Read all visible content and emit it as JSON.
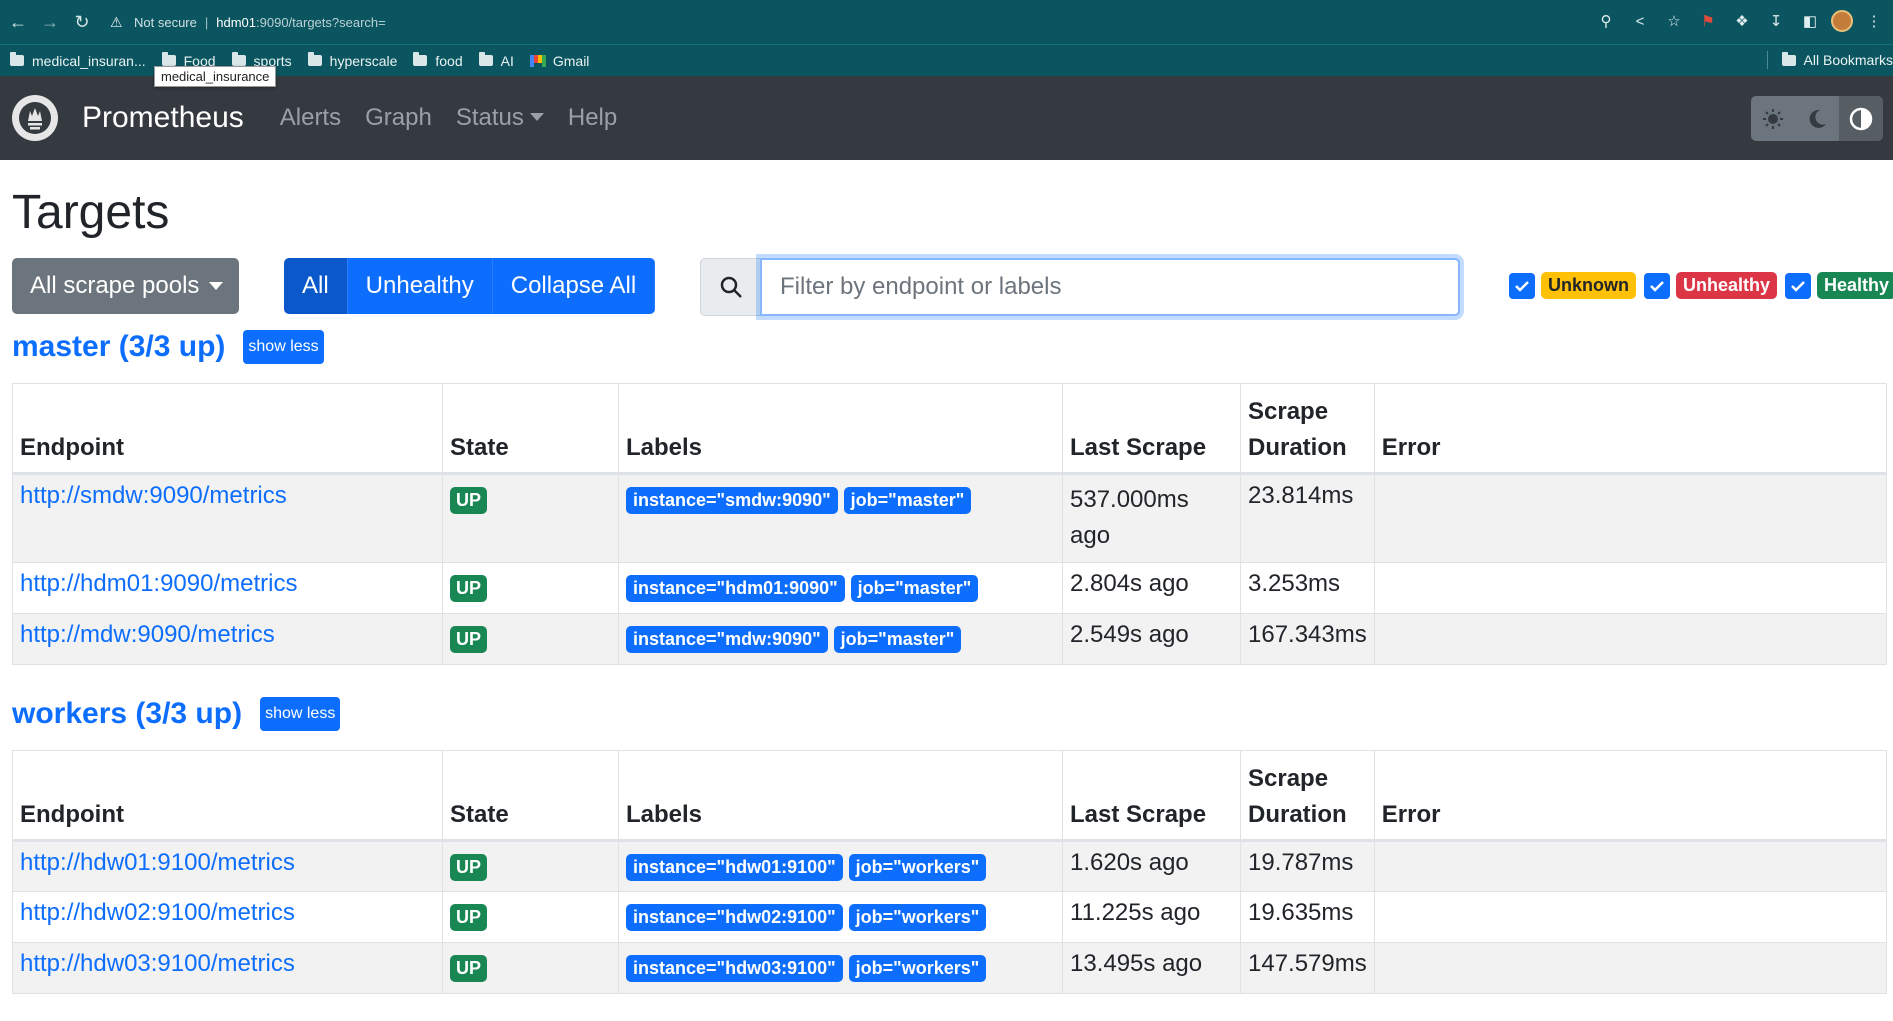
{
  "browser": {
    "security": "Not secure",
    "url_host": "hdm01",
    "url_path": ":9090/targets?search=",
    "bookmarks": [
      "medical_insuran...",
      "Food",
      "sports",
      "hyperscale",
      "food",
      "AI",
      "Gmail"
    ],
    "all_bookmarks": "All Bookmarks",
    "tooltip": "medical_insurance"
  },
  "navbar": {
    "brand": "Prometheus",
    "links": [
      "Alerts",
      "Graph",
      "Status",
      "Help"
    ]
  },
  "page": {
    "title": "Targets",
    "pool_dropdown": "All scrape pools",
    "buttons": {
      "all": "All",
      "unhealthy": "Unhealthy",
      "collapse": "Collapse All"
    },
    "search_placeholder": "Filter by endpoint or labels",
    "filters": {
      "unknown": "Unknown",
      "unhealthy": "Unhealthy",
      "healthy": "Healthy"
    }
  },
  "columns": {
    "endpoint": "Endpoint",
    "state": "State",
    "labels": "Labels",
    "last_scrape": "Last Scrape",
    "scrape_duration_1": "Scrape",
    "scrape_duration_2": "Duration",
    "error": "Error"
  },
  "pools": [
    {
      "title": "master (3/3 up)",
      "toggle": "show less",
      "rows": [
        {
          "endpoint": "http://smdw:9090/metrics",
          "state": "UP",
          "labels": [
            "instance=\"smdw:9090\"",
            "job=\"master\""
          ],
          "last_scrape": "537.000ms ago",
          "duration": "23.814ms",
          "error": ""
        },
        {
          "endpoint": "http://hdm01:9090/metrics",
          "state": "UP",
          "labels": [
            "instance=\"hdm01:9090\"",
            "job=\"master\""
          ],
          "last_scrape": "2.804s ago",
          "duration": "3.253ms",
          "error": ""
        },
        {
          "endpoint": "http://mdw:9090/metrics",
          "state": "UP",
          "labels": [
            "instance=\"mdw:9090\"",
            "job=\"master\""
          ],
          "last_scrape": "2.549s ago",
          "duration": "167.343ms",
          "error": ""
        }
      ]
    },
    {
      "title": "workers (3/3 up)",
      "toggle": "show less",
      "rows": [
        {
          "endpoint": "http://hdw01:9100/metrics",
          "state": "UP",
          "labels": [
            "instance=\"hdw01:9100\"",
            "job=\"workers\""
          ],
          "last_scrape": "1.620s ago",
          "duration": "19.787ms",
          "error": ""
        },
        {
          "endpoint": "http://hdw02:9100/metrics",
          "state": "UP",
          "labels": [
            "instance=\"hdw02:9100\"",
            "job=\"workers\""
          ],
          "last_scrape": "11.225s ago",
          "duration": "19.635ms",
          "error": ""
        },
        {
          "endpoint": "http://hdw03:9100/metrics",
          "state": "UP",
          "labels": [
            "instance=\"hdw03:9100\"",
            "job=\"workers\""
          ],
          "last_scrape": "13.495s ago",
          "duration": "147.579ms",
          "error": ""
        }
      ]
    }
  ],
  "colors": {
    "primary": "#0d6efd",
    "success": "#198754",
    "warning": "#ffc107",
    "danger": "#dc3545",
    "navbar": "#343a40",
    "browser_chrome": "#0b5560"
  }
}
